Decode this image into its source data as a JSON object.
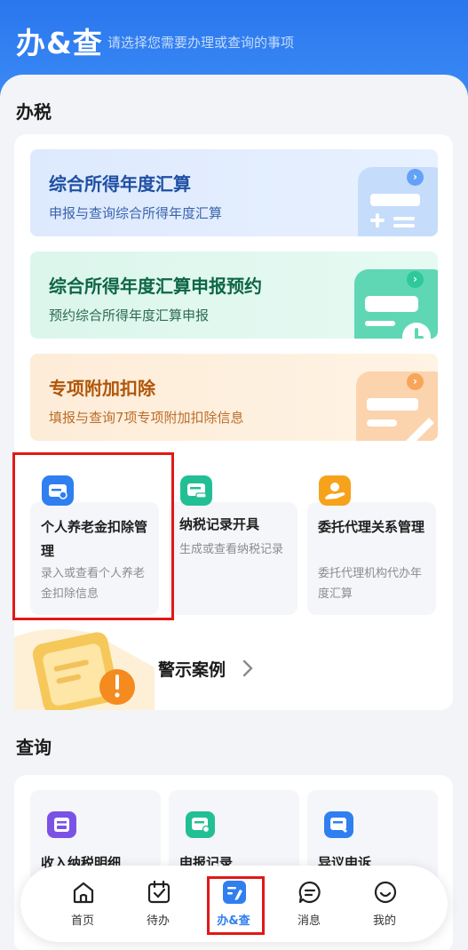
{
  "header": {
    "title": "办&查",
    "subtitle": "请选择您需要办理或查询的事项"
  },
  "tax_section": {
    "title": "办税",
    "banners": [
      {
        "title": "综合所得年度汇算",
        "desc": "申报与查询综合所得年度汇算"
      },
      {
        "title": "综合所得年度汇算申报预约",
        "desc": "预约综合所得年度汇算申报"
      },
      {
        "title": "专项附加扣除",
        "desc": "填报与查询7项专项附加扣除信息"
      }
    ],
    "services": [
      {
        "title": "个人养老金扣除管理",
        "desc": "录入或查看个人养老金扣除信息"
      },
      {
        "title": "纳税记录开具",
        "desc": "生成或查看纳税记录"
      },
      {
        "title": "委托代理关系管理",
        "desc": "委托代理机构代办年度汇算"
      }
    ],
    "warning": {
      "label": "警示案例"
    }
  },
  "query_section": {
    "title": "查询",
    "items": [
      {
        "title": "收入纳税明细"
      },
      {
        "title": "申报记录"
      },
      {
        "title": "异议申诉"
      }
    ]
  },
  "tabs": [
    {
      "label": "首页",
      "icon": "home-icon"
    },
    {
      "label": "待办",
      "icon": "calendar-check-icon"
    },
    {
      "label": "办&查",
      "icon": "handle-query-icon",
      "active": true
    },
    {
      "label": "消息",
      "icon": "message-icon"
    },
    {
      "label": "我的",
      "icon": "smile-icon"
    }
  ],
  "colors": {
    "brand": "#2a76ee",
    "highlight": "#e21818"
  }
}
